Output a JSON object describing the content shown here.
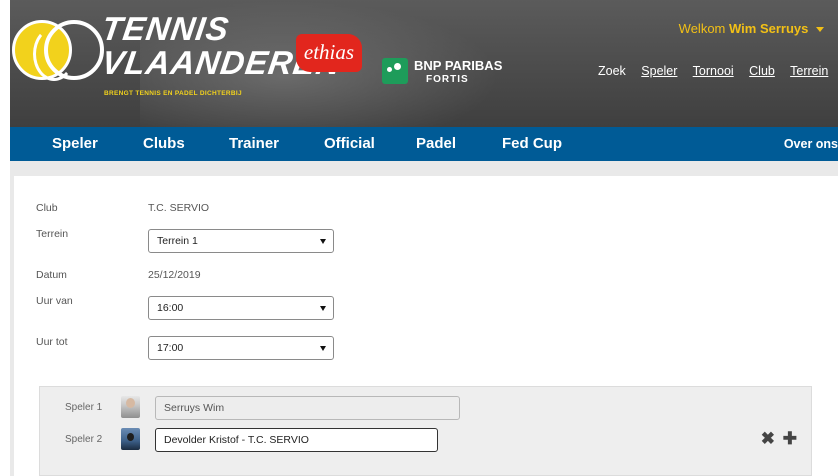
{
  "header": {
    "logo": {
      "line1": "TENNIS",
      "line2": "VLAANDEREN",
      "tagline": "BRENGT TENNIS EN PADEL DICHTERBIJ"
    },
    "sponsors": {
      "ethias": "ethias",
      "bnp_name": "BNP PARIBAS",
      "bnp_sub": "FORTIS"
    },
    "welcome": {
      "prefix": "Welkom",
      "user": "Wim Serruys"
    },
    "topnav": {
      "search": "Zoek",
      "links": [
        "Speler",
        "Tornooi",
        "Club",
        "Terrein"
      ]
    }
  },
  "mainnav": {
    "items": [
      "Speler",
      "Clubs",
      "Trainer",
      "Official",
      "Padel",
      "Fed Cup"
    ],
    "right": "Over ons"
  },
  "form": {
    "club_label": "Club",
    "club_value": "T.C. SERVIO",
    "terrein_label": "Terrein",
    "terrein_value": "Terrein 1",
    "datum_label": "Datum",
    "datum_value": "25/12/2019",
    "uur_van_label": "Uur van",
    "uur_van_value": "16:00",
    "uur_tot_label": "Uur tot",
    "uur_tot_value": "17:00"
  },
  "players": {
    "speler1_label": "Speler 1",
    "speler1_value": "Serruys Wim",
    "speler2_label": "Speler 2",
    "speler2_value": "Devolder Kristof - T.C. SERVIO",
    "remove_icon": "✖",
    "add_icon": "✚"
  },
  "colors": {
    "nav_blue": "#005b96",
    "accent_yellow": "#f2c016"
  }
}
